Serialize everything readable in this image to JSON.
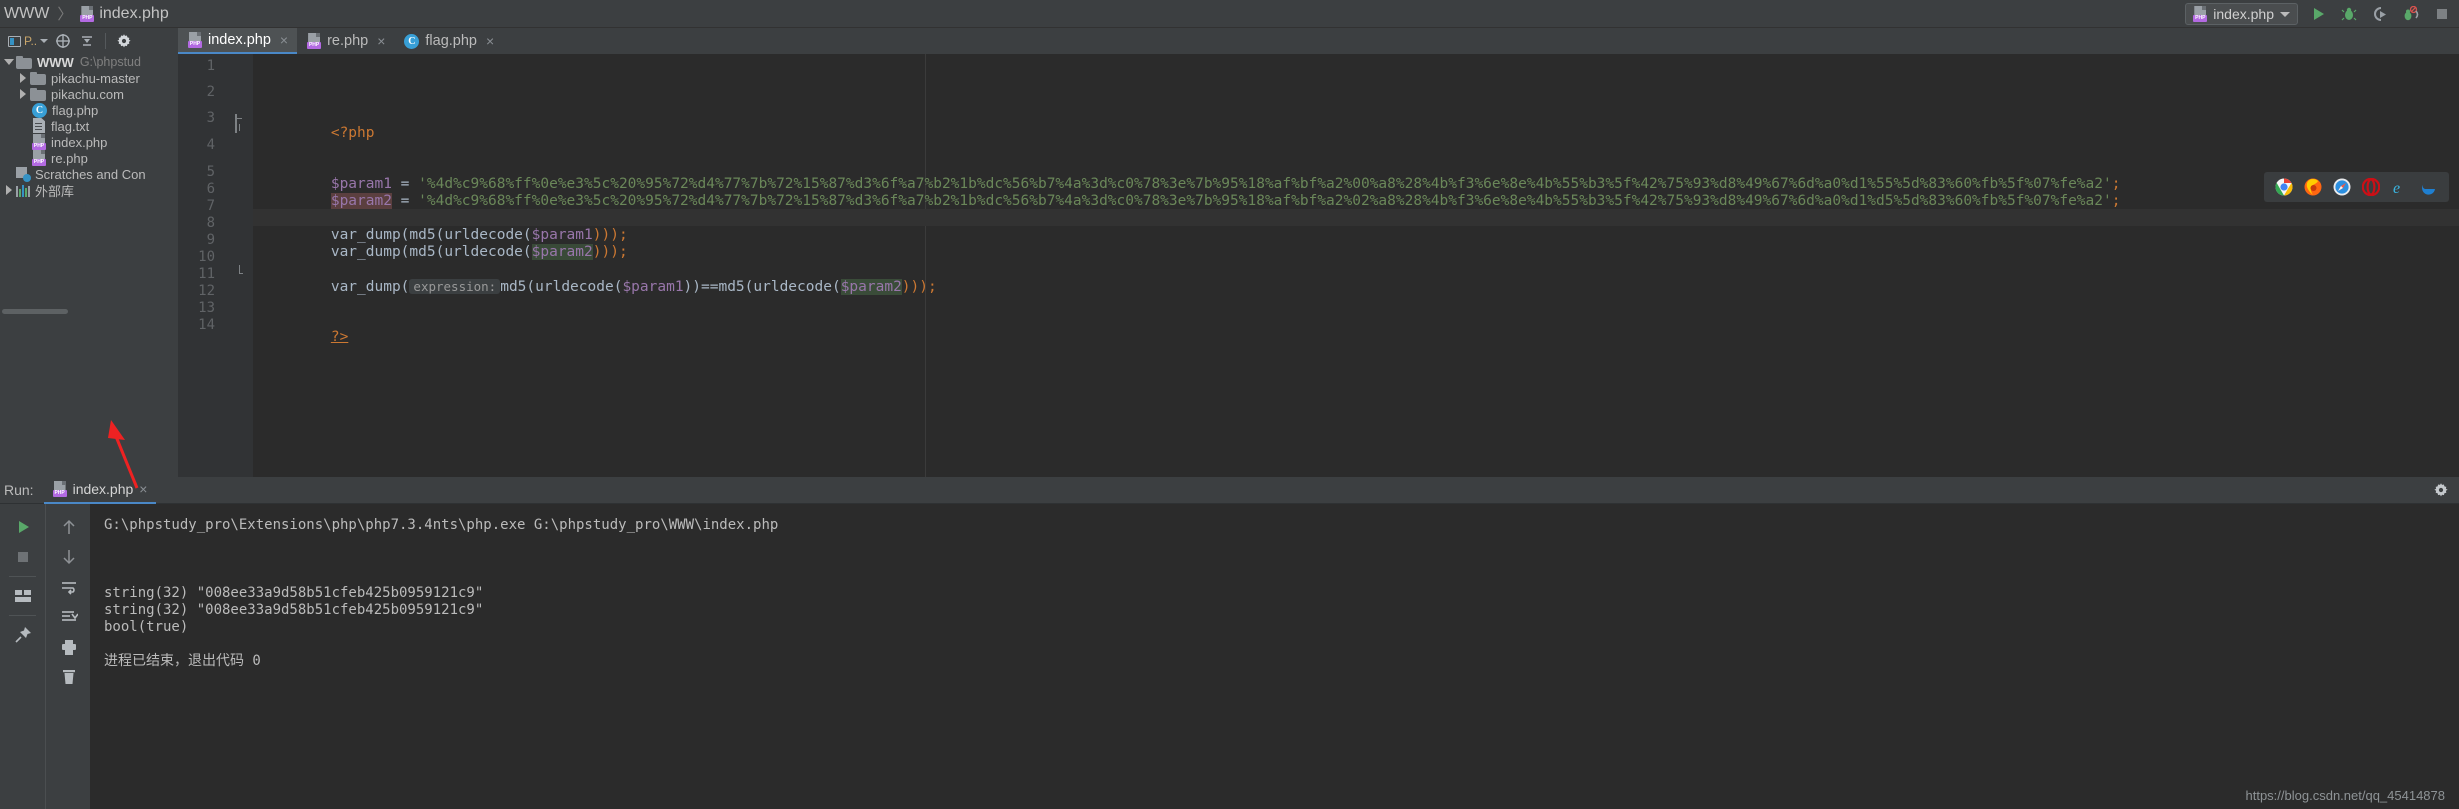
{
  "app": {
    "theme_bg": "#3c3f41",
    "editor_bg": "#2b2b2b",
    "accent": "#4a88c7"
  },
  "breadcrumb": {
    "root": "WWW",
    "separator": "〉",
    "file": "index.php"
  },
  "run_config": {
    "name": "index.php",
    "run_icon": "play-icon",
    "debug_icon": "bug-icon",
    "run_with_coverage_icon": "coverage-icon",
    "profile_icon": "profile-bug-icon",
    "stop_icon": "stop-icon"
  },
  "toolbar": {
    "project_label": "P..",
    "project_icon": "project-view-icon",
    "dropdown_icon": "chevron-down-icon",
    "target_icon": "crosshair-icon",
    "collapse_icon": "collapse-all-icon",
    "settings_icon": "gear-icon"
  },
  "tabs": [
    {
      "label": "index.php",
      "icon": "php-file-icon",
      "active": true,
      "close": "×"
    },
    {
      "label": "re.php",
      "icon": "php-file-icon",
      "active": false,
      "close": "×"
    },
    {
      "label": "flag.php",
      "icon": "class-file-icon",
      "active": false,
      "close": "×"
    }
  ],
  "project_tree": [
    {
      "label": "WWW",
      "sub": "G:\\phpstud",
      "icon": "folder-icon",
      "twisty": "down",
      "indent": 0,
      "bold": true
    },
    {
      "label": "pikachu-master",
      "sub": "",
      "icon": "folder-icon",
      "twisty": "right",
      "indent": 1,
      "bold": false
    },
    {
      "label": "pikachu.com",
      "sub": "",
      "icon": "folder-icon",
      "twisty": "right",
      "indent": 1,
      "bold": false
    },
    {
      "label": "flag.php",
      "sub": "",
      "icon": "class-file-icon",
      "twisty": "none",
      "indent": 2,
      "bold": false
    },
    {
      "label": "flag.txt",
      "sub": "",
      "icon": "text-file-icon",
      "twisty": "none",
      "indent": 2,
      "bold": false
    },
    {
      "label": "index.php",
      "sub": "",
      "icon": "php-file-icon",
      "twisty": "none",
      "indent": 2,
      "bold": false
    },
    {
      "label": "re.php",
      "sub": "",
      "icon": "php-file-icon",
      "twisty": "none",
      "indent": 2,
      "bold": false
    },
    {
      "label": "Scratches and Con",
      "sub": "",
      "icon": "scratches-icon",
      "twisty": "none",
      "indent": 0,
      "bold": false
    },
    {
      "label": "外部库",
      "sub": "",
      "icon": "external-libraries-icon",
      "twisty": "right",
      "indent": 0,
      "bold": false
    }
  ],
  "editor": {
    "line_numbers": [
      "1",
      "2",
      "3",
      "4",
      "5",
      "6",
      "7",
      "8",
      "9",
      "10",
      "11",
      "12",
      "13",
      "14"
    ],
    "code": {
      "php_open": "<?php",
      "param1_name": "$param1",
      "param2_name": "$param2",
      "assign": " = ",
      "param1_value": "'%4d%c9%68%ff%0e%e3%5c%20%95%72%d4%77%7b%72%15%87%d3%6f%a7%b2%1b%dc%56%b7%4a%3d%c0%78%3e%7b%95%18%af%bf%a2%00%a8%28%4b%f3%6e%8e%4b%55%b3%5f%42%75%93%d8%49%67%6d%a0%d1%55%5d%83%60%fb%5f%07%fe%a2'",
      "param2_value": "'%4d%c9%68%ff%0e%e3%5c%20%95%72%d4%77%7b%72%15%87%d3%6f%a7%b2%1b%dc%56%b7%4a%3d%c0%78%3e%7b%95%18%af%bf%a2%02%a8%28%4b%f3%6e%8e%4b%55%b3%5f%42%75%93%d8%49%67%6d%a0%d1%d5%5d%83%60%fb%5f%07%fe%a2'",
      "semicolon": ";",
      "line8": "var_dump(md5(urldecode(",
      "line8_end": ")));",
      "line9": "var_dump(md5(urldecode(",
      "line9_end": ")));",
      "line11_prefix": "var_dump(",
      "line11_hint": "expression:",
      "line11_expr_a": "md5(urldecode(",
      "line11_expr_mid": "))==md5(urldecode(",
      "line11_expr_end": ")));",
      "php_close": "?>"
    },
    "inlay_hint_label": "expression:",
    "bulb_icon": "intention-bulb-icon",
    "browsers": [
      {
        "name": "chrome-icon",
        "color": "#4285f4"
      },
      {
        "name": "firefox-icon",
        "color": "#e66000"
      },
      {
        "name": "safari-icon",
        "color": "#1b9df3"
      },
      {
        "name": "opera-icon",
        "color": "#cc0f16"
      },
      {
        "name": "internet-explorer-icon",
        "color": "#1ebbee"
      },
      {
        "name": "edge-icon",
        "color": "#0f7ec8"
      }
    ]
  },
  "run_panel": {
    "label": "Run:",
    "tab_name": "index.php",
    "tab_close": "×",
    "settings_icon": "gear-icon",
    "toolbar_icons": [
      "rerun-icon",
      "stop-icon",
      "layout-icon",
      "pin-icon",
      "up-arrow-icon",
      "down-arrow-icon",
      "soft-wrap-icon",
      "scroll-to-end-icon",
      "print-icon",
      "clear-all-icon"
    ],
    "console_lines": [
      "G:\\phpstudy_pro\\Extensions\\php\\php7.3.4nts\\php.exe G:\\phpstudy_pro\\WWW\\index.php",
      "",
      "",
      "string(32) \"008ee33a9d58b51cfeb425b0959121c9\"",
      "string(32) \"008ee33a9d58b51cfeb425b0959121c9\"",
      "bool(true)",
      "",
      "进程已结束，退出代码 0"
    ],
    "annotation_arrow_color": "#ee2222"
  },
  "watermark": "https://blog.csdn.net/qq_45414878"
}
